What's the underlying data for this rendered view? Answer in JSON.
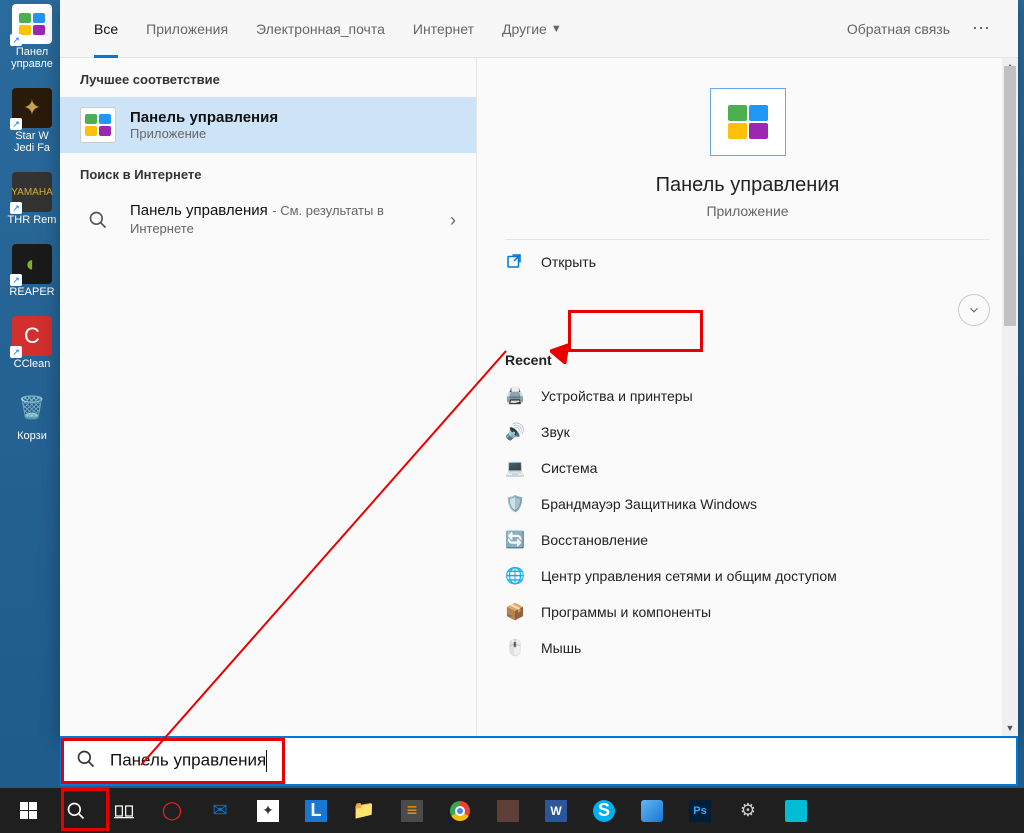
{
  "tabs": {
    "all": "Все",
    "apps": "Приложения",
    "email": "Электронная_почта",
    "internet": "Интернет",
    "other": "Другие",
    "feedback": "Обратная связь"
  },
  "left": {
    "best_match": "Лучшее соответствие",
    "result_title": "Панель управления",
    "result_sub": "Приложение",
    "web_hdr": "Поиск в Интернете",
    "web_title": "Панель управления",
    "web_sub": "- См. результаты в Интернете"
  },
  "preview": {
    "title": "Панель управления",
    "sub": "Приложение",
    "open": "Открыть",
    "recent": "Recent",
    "items": [
      "Устройства и принтеры",
      "Звук",
      "Система",
      "Брандмауэр Защитника Windows",
      "Восстановление",
      "Центр управления сетями и общим доступом",
      "Программы и компоненты",
      "Мышь"
    ]
  },
  "search": {
    "value": "Панель управления"
  },
  "desktop": {
    "icons": [
      "Панел\nуправле",
      "Star W\nJedi Fa",
      "THR Rem",
      "REAPER",
      "CClean",
      "Корзи"
    ]
  }
}
